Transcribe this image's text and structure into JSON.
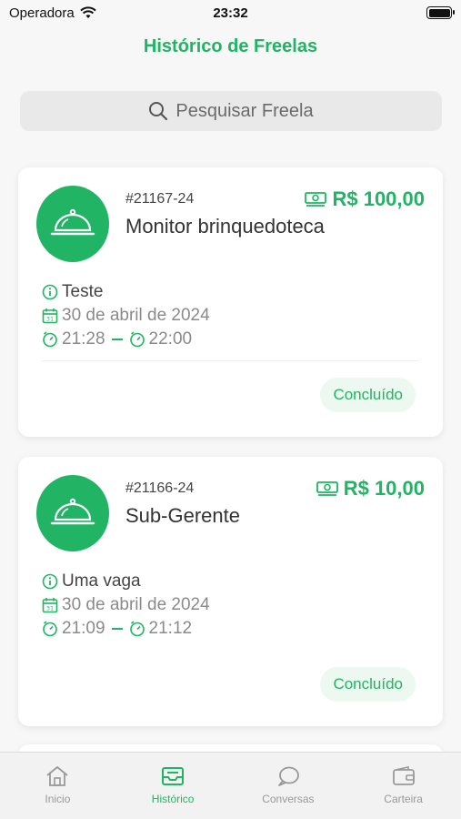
{
  "status_bar": {
    "carrier": "Operadora",
    "time": "23:32"
  },
  "header": {
    "title": "Histórico de Freelas"
  },
  "search": {
    "placeholder": "Pesquisar Freela"
  },
  "freelas": [
    {
      "code": "#21167-24",
      "job": "Monitor brinquedoteca",
      "price": "R$ 100,00",
      "description": "Teste",
      "date": "30 de abril de 2024",
      "start": "21:28",
      "end": "22:00",
      "status": "Concluído"
    },
    {
      "code": "#21166-24",
      "job": "Sub-Gerente",
      "price": "R$ 10,00",
      "description": "Uma vaga",
      "date": "30 de abril de 2024",
      "start": "21:09",
      "end": "21:12",
      "status": "Concluído"
    }
  ],
  "tabs": [
    {
      "label": "Inicio",
      "icon": "home-icon",
      "active": false
    },
    {
      "label": "Histórico",
      "icon": "inbox-icon",
      "active": true
    },
    {
      "label": "Conversas",
      "icon": "chat-icon",
      "active": false
    },
    {
      "label": "Carteira",
      "icon": "wallet-icon",
      "active": false
    }
  ],
  "colors": {
    "accent": "#20b464",
    "badge_bg": "#ecf8f0",
    "background": "#f7f7f7"
  }
}
